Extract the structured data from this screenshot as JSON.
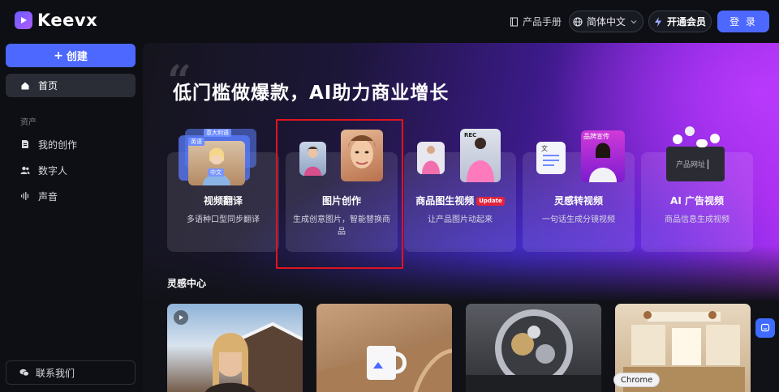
{
  "header": {
    "logo_text": "Keevx",
    "manual_label": "产品手册",
    "language_label": "简体中文",
    "vip_label": "开通会员",
    "login_label": "登 录"
  },
  "sidebar": {
    "create_label": "创建",
    "home_label": "首页",
    "assets_section": "资产",
    "items": [
      {
        "label": "我的创作",
        "icon": "document-icon"
      },
      {
        "label": "数字人",
        "icon": "people-icon"
      },
      {
        "label": "声音",
        "icon": "audio-icon"
      }
    ],
    "contact_label": "联系我们"
  },
  "hero": {
    "title": "低门槛做爆款，AI助力商业增长",
    "cards": [
      {
        "title": "视频翻译",
        "desc": "多语种口型同步翻译",
        "art_tags": [
          "意大利语",
          "英语",
          "中文"
        ]
      },
      {
        "title": "图片创作",
        "desc": "生成创意图片，智能替换商品"
      },
      {
        "title": "商品图生视频",
        "badge": "Update",
        "desc": "让产品图片动起来",
        "art_tag": "REC"
      },
      {
        "title": "灵感转视频",
        "desc": "一句话生成分镜视频",
        "art_tags": [
          "文",
          "品牌宣传"
        ]
      },
      {
        "title": "AI 广告视频",
        "desc": "商品信息生成视频",
        "art_input": "产品网址"
      }
    ]
  },
  "inspiration": {
    "title": "灵感中心"
  },
  "overlay": {
    "chrome_tooltip": "Chrome"
  },
  "colors": {
    "accent": "#4c68ff",
    "highlight_border": "#e0141e",
    "badge_red": "#e5233c"
  }
}
